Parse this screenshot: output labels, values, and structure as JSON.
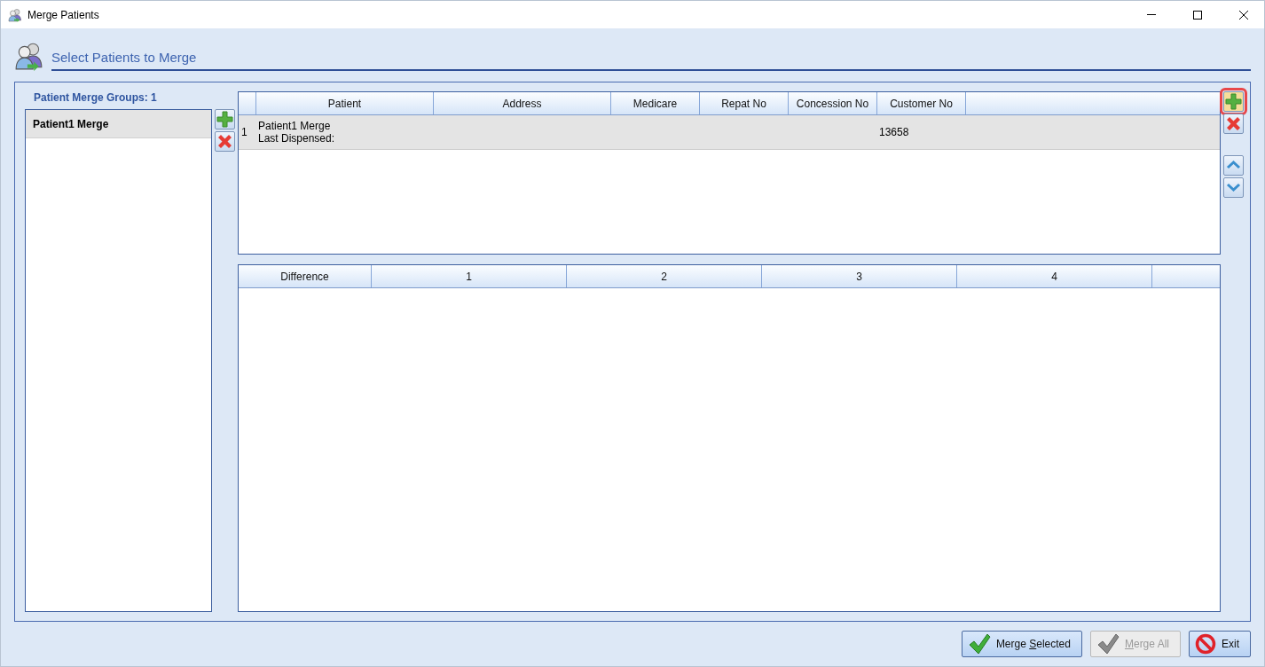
{
  "window": {
    "title": "Merge Patients"
  },
  "header": {
    "title": "Select Patients to Merge"
  },
  "groups": {
    "label": "Patient Merge Groups: 1",
    "items": [
      {
        "name": "Patient1 Merge",
        "selected": true
      }
    ]
  },
  "patients_table": {
    "columns": [
      "Patient",
      "Address",
      "Medicare",
      "Repat No",
      "Concession No",
      "Customer No"
    ],
    "rows": [
      {
        "index": "1",
        "patient": "Patient1 Merge",
        "last_dispensed": "Last Dispensed:",
        "customer_no": "13658",
        "selected": true
      }
    ]
  },
  "side_buttons": [
    {
      "kind": "add",
      "highlighted": true
    },
    {
      "kind": "remove",
      "highlighted": false
    },
    {
      "kind": "up",
      "highlighted": false
    },
    {
      "kind": "down",
      "highlighted": false
    }
  ],
  "differences_table": {
    "columns": [
      "Difference",
      "1",
      "2",
      "3",
      "4"
    ]
  },
  "buttons": [
    {
      "kind": "check",
      "label_before": "Merge ",
      "underlined": "S",
      "label_after": "elected",
      "disabled": false
    },
    {
      "kind": "check",
      "underlined": "M",
      "label_after": "erge All",
      "disabled": true
    },
    {
      "kind": "exit",
      "label_before": "Exit",
      "disabled": false
    }
  ]
}
